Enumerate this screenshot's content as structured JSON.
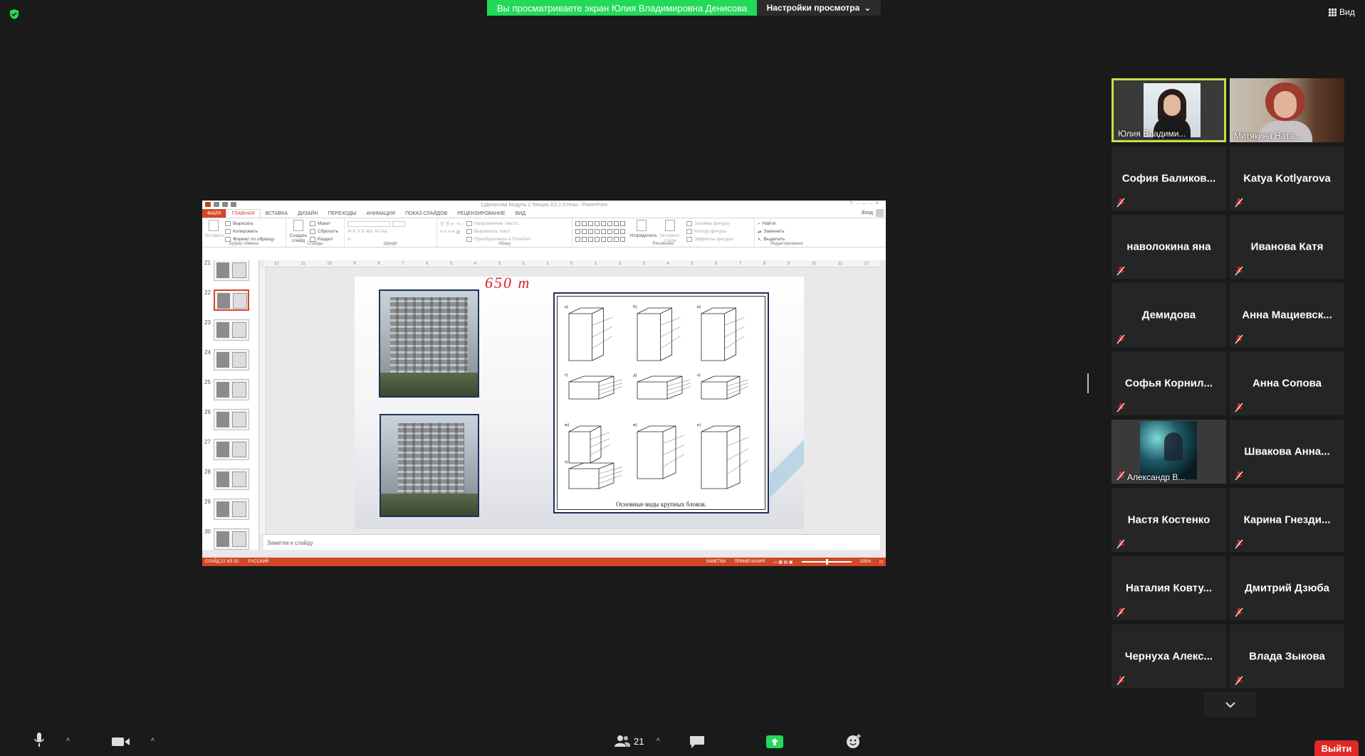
{
  "top": {
    "share_banner": "Вы просматриваете экран Юлия Владимировна Денисова",
    "view_settings": "Настройки просмотра",
    "view_button": "Вид"
  },
  "ppt": {
    "window_title": "1)Денисова Модуль 2 Лекция 2(2.2 Стены - PowerPoint",
    "tabs": [
      "ФАЙЛ",
      "ГЛАВНАЯ",
      "ВСТАВКА",
      "ДИЗАЙН",
      "ПЕРЕХОДЫ",
      "АНИМАЦИЯ",
      "ПОКАЗ СЛАЙДОВ",
      "РЕЦЕНЗИРОВАНИЕ",
      "ВИД"
    ],
    "login": "Вход",
    "ribbon": {
      "clipboard": {
        "paste": "Вставить",
        "cut": "Вырезать",
        "copy": "Копировать",
        "format": "Формат по образцу",
        "caption": "Буфер обмена"
      },
      "slides": {
        "create": "Создать слайд",
        "layout": "Макет",
        "reset": "Сбросить",
        "section": "Раздел",
        "caption": "Слайды"
      },
      "font": {
        "caption": "Шрифт"
      },
      "paragraph": {
        "text_dir": "Направление текста",
        "align_text": "Выровнять текст",
        "smartart": "Преобразовать в SmartArt",
        "caption": "Абзац"
      },
      "drawing": {
        "arrange": "Упорядочить",
        "quick_styles": "Экспресс-стили",
        "fill": "Заливка фигуры",
        "outline": "Контур фигуры",
        "effects": "Эффекты фигуры",
        "caption": "Рисование"
      },
      "editing": {
        "find": "Найти",
        "replace": "Заменить",
        "select": "Выделить",
        "caption": "Редактирование"
      }
    },
    "ruler_ticks": [
      "12",
      "11",
      "10",
      "9",
      "8",
      "7",
      "6",
      "5",
      "4",
      "3",
      "2",
      "1",
      "0",
      "1",
      "2",
      "3",
      "4",
      "5",
      "6",
      "7",
      "8",
      "9",
      "10",
      "11",
      "12"
    ],
    "thumbnails": [
      "21",
      "22",
      "23",
      "24",
      "25",
      "26",
      "27",
      "28",
      "29",
      "30"
    ],
    "selected_thumbnail": "22",
    "slide": {
      "ink": "650 т",
      "caption": "Основные виды крупных блоков.",
      "drawing_labels": [
        "а)",
        "б)",
        "в)",
        "г)",
        "д)",
        "е)",
        "ж)",
        "и)",
        "к)",
        "з)"
      ]
    },
    "notes_placeholder": "Заметки к слайду",
    "status": {
      "slide": "СЛАЙД 22 ИЗ 33",
      "lang": "РУССКИЙ",
      "notes": "ЗАМЕТКИ",
      "comments": "ПРИМЕЧАНИЯ",
      "zoom": "105%"
    }
  },
  "participants": [
    {
      "name": "Юлия Владими...",
      "video": true,
      "active": true
    },
    {
      "name": "Митякина Ната...",
      "video": true,
      "active": false
    },
    {
      "name": "София  Баликов...",
      "video": false
    },
    {
      "name": "Katya Kotlyarova",
      "video": false
    },
    {
      "name": "наволокина яна",
      "video": false
    },
    {
      "name": "Иванова Катя",
      "video": false
    },
    {
      "name": "Демидова",
      "video": false
    },
    {
      "name": "Анна  Мациевск...",
      "video": false
    },
    {
      "name": "Софья  Корнил...",
      "video": false
    },
    {
      "name": "Анна Сопова",
      "video": false
    },
    {
      "name": "Александр В...",
      "video": true,
      "active": false
    },
    {
      "name": "Швакова  Анна...",
      "video": false
    },
    {
      "name": "Настя Костенко",
      "video": false
    },
    {
      "name": "Карина  Гнезди...",
      "video": false
    },
    {
      "name": "Наталия  Ковту...",
      "video": false
    },
    {
      "name": "Дмитрий Дзюба",
      "video": false
    },
    {
      "name": "Чернуха  Алекс...",
      "video": false
    },
    {
      "name": "Влада Зыкова",
      "video": false
    }
  ],
  "toolbar": {
    "participants_count": "21",
    "leave": "Выйти"
  },
  "colors": {
    "accent_green": "#23d959",
    "ppt_orange": "#d24726",
    "active_speaker": "#c6e04a",
    "leave_red": "#e02828"
  }
}
